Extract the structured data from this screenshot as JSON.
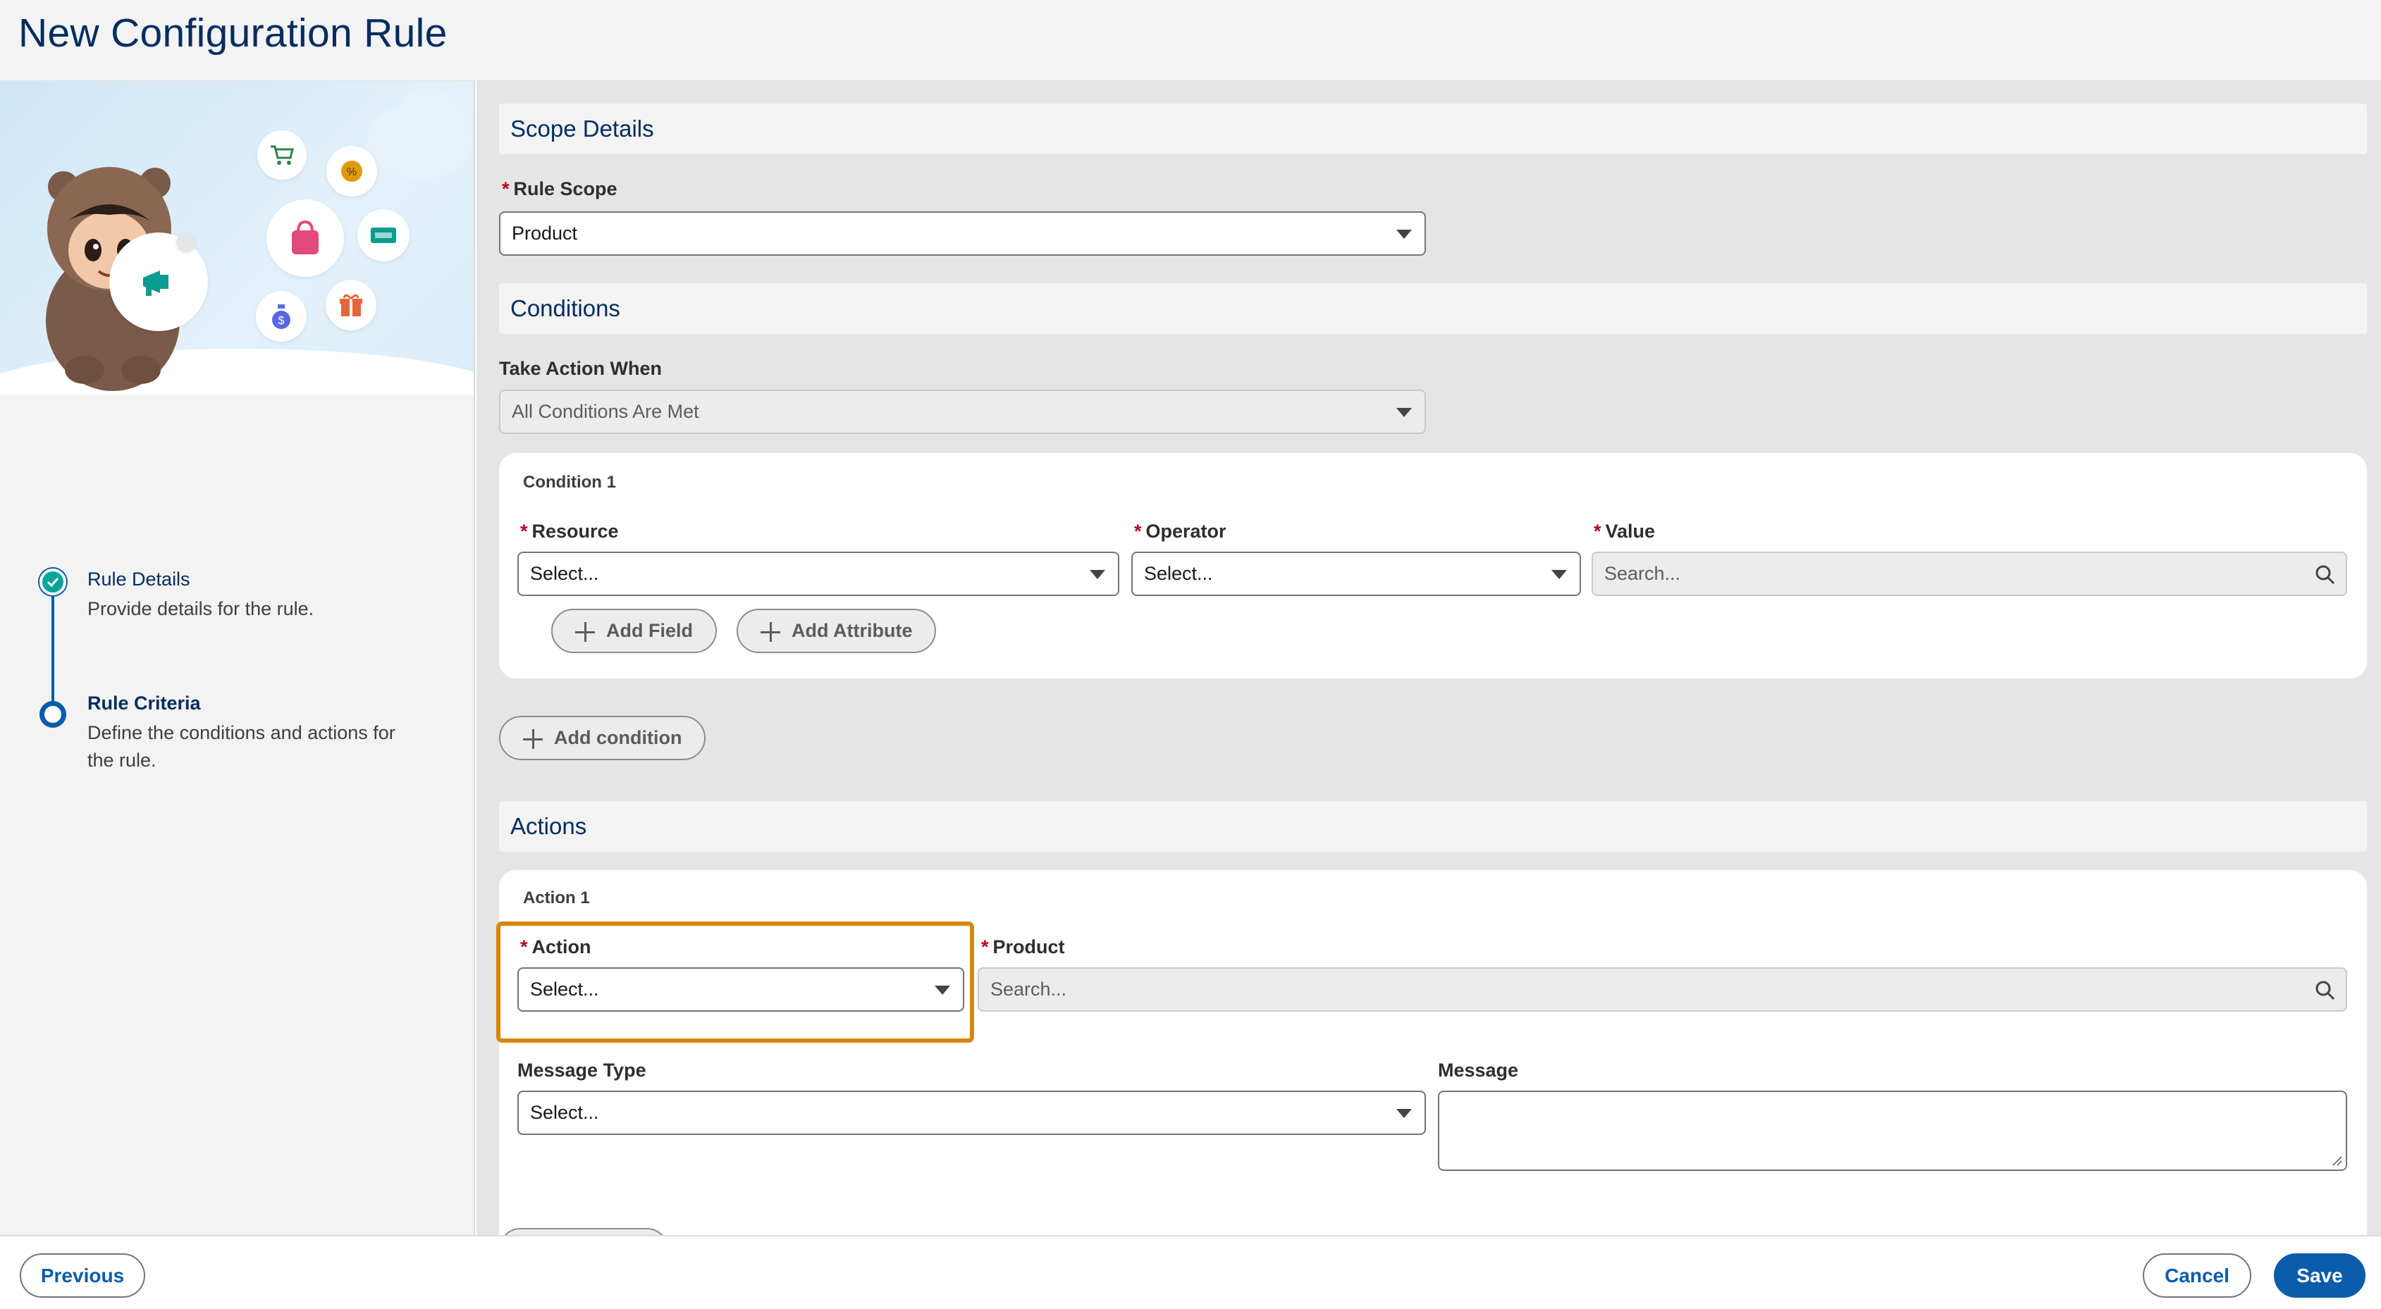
{
  "page": {
    "title": "New Configuration Rule"
  },
  "steps": [
    {
      "title": "Rule Details",
      "description": "Provide details for the rule.",
      "status": "complete"
    },
    {
      "title": "Rule Criteria",
      "description": "Define the conditions and actions for the rule.",
      "status": "active"
    }
  ],
  "scope": {
    "header": "Scope Details",
    "rule_scope_label": "Rule Scope",
    "rule_scope_value": "Product"
  },
  "conditions": {
    "header": "Conditions",
    "take_action_label": "Take Action When",
    "take_action_value": "All Conditions Are Met",
    "condition1": {
      "title": "Condition 1",
      "resource_label": "Resource",
      "resource_value": "Select...",
      "operator_label": "Operator",
      "operator_value": "Select...",
      "value_label": "Value",
      "value_placeholder": "Search...",
      "add_field": "Add Field",
      "add_attribute": "Add Attribute"
    },
    "add_condition": "Add condition"
  },
  "actions": {
    "header": "Actions",
    "action1": {
      "title": "Action 1",
      "action_label": "Action",
      "action_value": "Select...",
      "product_label": "Product",
      "product_placeholder": "Search...",
      "message_type_label": "Message Type",
      "message_type_value": "Select...",
      "message_label": "Message"
    }
  },
  "footer": {
    "previous": "Previous",
    "cancel": "Cancel",
    "save": "Save"
  },
  "colors": {
    "brand": "#0b5cab",
    "title": "#032d60",
    "required": "#ba0517",
    "highlight": "#d4860f",
    "step_complete": "#06a59a"
  }
}
